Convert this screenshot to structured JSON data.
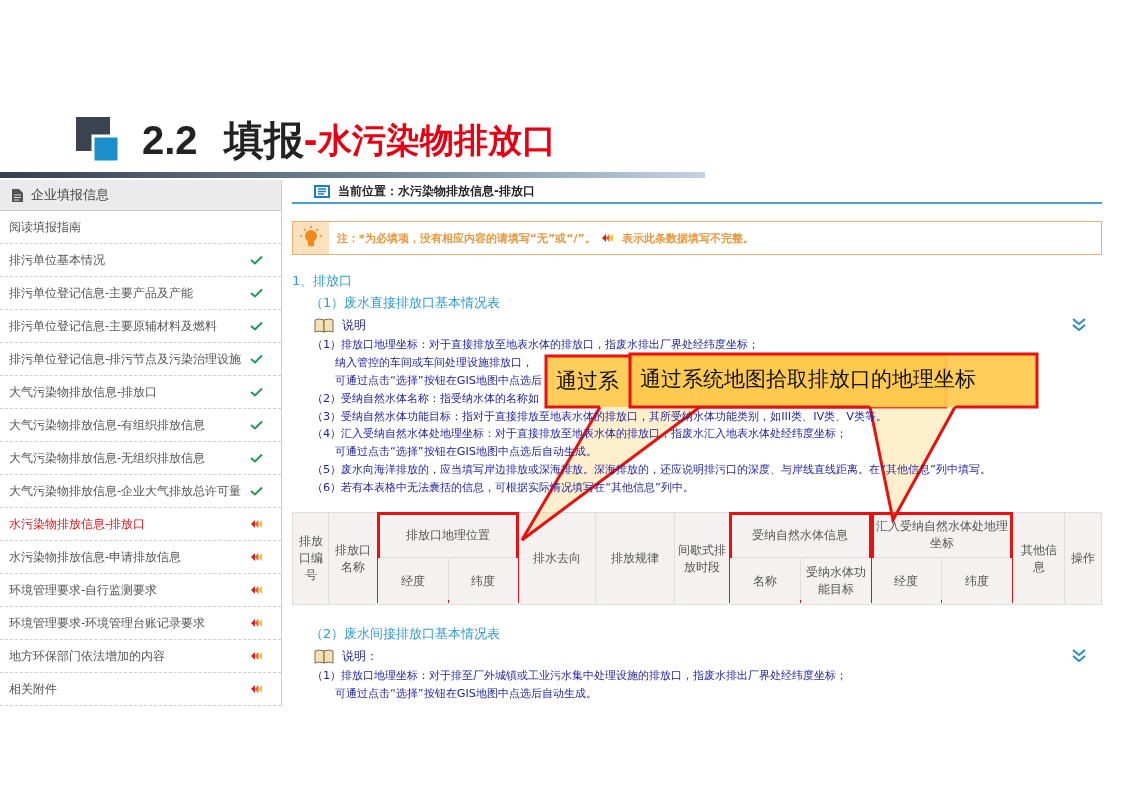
{
  "title": {
    "number": "2.2",
    "main": "填报",
    "sub": "-水污染物排放口"
  },
  "sidebar": {
    "header": "企业填报信息",
    "items": [
      {
        "label": "阅读填报指南",
        "kind": "plain",
        "selected": false
      },
      {
        "label": "排污单位基本情况",
        "kind": "complete",
        "selected": false
      },
      {
        "label": "排污单位登记信息-主要产品及产能",
        "kind": "complete",
        "selected": false
      },
      {
        "label": "排污单位登记信息-主要原辅材料及燃料",
        "kind": "complete",
        "selected": false
      },
      {
        "label": "排污单位登记信息-排污节点及污染治理设施",
        "kind": "complete",
        "selected": false
      },
      {
        "label": "大气污染物排放信息-排放口",
        "kind": "complete",
        "selected": false
      },
      {
        "label": "大气污染物排放信息-有组织排放信息",
        "kind": "complete",
        "selected": false
      },
      {
        "label": "大气污染物排放信息-无组织排放信息",
        "kind": "complete",
        "selected": false
      },
      {
        "label": "大气污染物排放信息-企业大气排放总许可量",
        "kind": "complete",
        "selected": false
      },
      {
        "label": "水污染物排放信息-排放口",
        "kind": "incomplete",
        "selected": true
      },
      {
        "label": "水污染物排放信息-申请排放信息",
        "kind": "incomplete",
        "selected": false
      },
      {
        "label": "环境管理要求-自行监测要求",
        "kind": "incomplete",
        "selected": false
      },
      {
        "label": "环境管理要求-环境管理台账记录要求",
        "kind": "incomplete",
        "selected": false
      },
      {
        "label": "地方环保部门依法增加的内容",
        "kind": "incomplete",
        "selected": false
      },
      {
        "label": "相关附件",
        "kind": "incomplete",
        "selected": false
      }
    ]
  },
  "breadcrumb": "当前位置：水污染物排放信息-排放口",
  "notice": {
    "before": "注：*为必填项，没有相应内容的请填写“无”或“/”。",
    "after": "表示此条数据填写不完整。"
  },
  "section_title": "1、排放口",
  "tables": [
    {
      "title": "（1）废水直接排放口基本情况表",
      "notes_label": "说明",
      "notes": [
        {
          "lines": [
            "（1）排放口地理坐标：对于直接排放至地表水体的排放口，指废水排出厂界处经纬度坐标；",
            "纳入管控的车间或车间处理设施排放口，",
            "可通过点击“选择”按钮在GIS地图中点选后"
          ]
        },
        {
          "lines": [
            "（2）受纳自然水体名称：指受纳水体的名称如"
          ]
        },
        {
          "lines": [
            "（3）受纳自然水体功能目标：指对于直接排放至地表水体的排放口，其所受纳水体功能类别，如III类、IV类、V类等。"
          ]
        },
        {
          "lines": [
            "（4）汇入受纳自然水体处地理坐标：对于直接排放至地表水体的排放口，指废水汇入地表水体处经纬度坐标；",
            "可通过点击“选择”按钮在GIS地图中点选后自动生成。"
          ]
        },
        {
          "lines": [
            "（5）废水向海洋排放的，应当填写岸边排放或深海排放。深海排放的，还应说明排污口的深度、与岸线直线距离。在“其他信息”列中填写。"
          ]
        },
        {
          "lines": [
            "（6）若有本表格中无法囊括的信息，可根据实际情况填写在“其他信息”列中。"
          ]
        }
      ],
      "columns": [
        {
          "label": "排放口编号",
          "highlighted": false
        },
        {
          "label": "排放口名称",
          "highlighted": false
        },
        {
          "label": "排放口地理位置",
          "highlighted": true,
          "children": [
            "经度",
            "纬度"
          ]
        },
        {
          "label": "排水去向",
          "highlighted": false
        },
        {
          "label": "排放规律",
          "highlighted": false
        },
        {
          "label": "间歇式排放时段",
          "highlighted": false
        },
        {
          "label": "受纳自然水体信息",
          "highlighted": true,
          "children": [
            "名称",
            "受纳水体功能目标"
          ]
        },
        {
          "label": "汇入受纳自然水体处地理坐标",
          "highlighted": true,
          "children": [
            "经度",
            "纬度"
          ]
        },
        {
          "label": "其他信息",
          "highlighted": false
        },
        {
          "label": "操作",
          "highlighted": false
        }
      ]
    },
    {
      "title": "（2）废水间接排放口基本情况表",
      "notes_label": "说明：",
      "notes": [
        {
          "lines": [
            "（1）排放口地理坐标：对于排至厂外城镇或工业污水集中处理设施的排放口，指废水排出厂界处经纬度坐标；",
            "可通过点击“选择”按钮在GIS地图中点选后自动生成。"
          ]
        }
      ]
    }
  ],
  "callouts": [
    {
      "text": "通过系"
    },
    {
      "text": "通过系统地图拾取排放口的地理坐标"
    }
  ]
}
